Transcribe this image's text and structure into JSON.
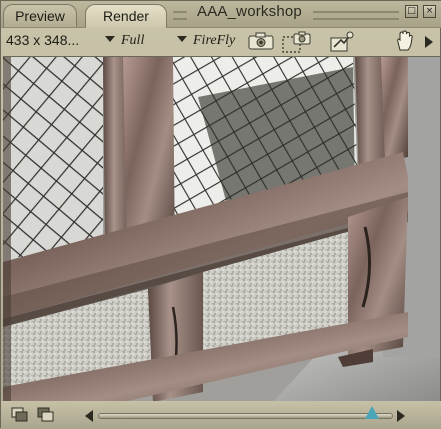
{
  "tabs": [
    {
      "label": "Preview",
      "active": false
    },
    {
      "label": "Render",
      "active": true
    }
  ],
  "window": {
    "title": "AAA_workshop",
    "buttons": [
      "maximize-icon",
      "close-icon"
    ]
  },
  "toolbar": {
    "resolution": "433 x 348...",
    "render_size": "Full",
    "renderer": "FireFly",
    "icons": [
      "render-camera-icon",
      "area-render-icon",
      "render-settings-icon",
      "hand-pan-icon",
      "expand-arrow-icon"
    ]
  },
  "colors": {
    "panel": "#bdb79d",
    "slider_thumb": "#49a7b9",
    "viewport_bg": "#9b9b98"
  },
  "bottombar": {
    "icons": [
      "render-history-icon",
      "compare-renders-icon"
    ],
    "slider_position_fraction": 0.93
  }
}
